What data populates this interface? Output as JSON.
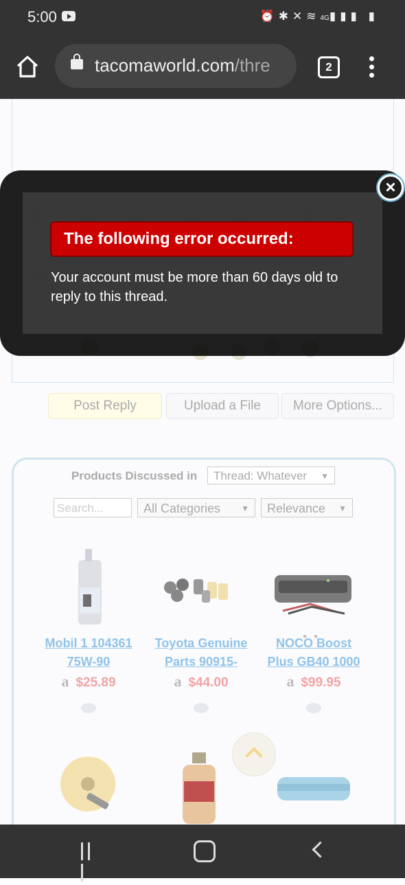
{
  "status_bar": {
    "time": "5:00",
    "icons": [
      "alarm-icon",
      "bluetooth-icon",
      "mute-icon",
      "wifi-icon",
      "lte-icon",
      "signal-icon",
      "battery-icon"
    ],
    "network_label": "4G"
  },
  "browser": {
    "url_main": "tacomaworld.com",
    "url_rest": "/thre",
    "tab_count": "2"
  },
  "editor_buttons": {
    "post_reply": "Post Reply",
    "upload_file": "Upload a File",
    "more_options": "More Options..."
  },
  "products": {
    "heading": "Products Discussed in",
    "thread_select": "Thread: Whatever",
    "search_placeholder": "Search...",
    "category": "All Categories",
    "sort": "Relevance",
    "items": [
      {
        "title_line1": "Mobil 1 104361",
        "title_line2": "75W-90",
        "price": "$25.89",
        "store_icon": "amazon-icon"
      },
      {
        "title_line1": "Toyota Genuine",
        "title_line2": "Parts 90915-",
        "price": "$44.00",
        "store_icon": "amazon-icon"
      },
      {
        "title_line1": "NOCO Boost",
        "title_line2": "Plus GB40 1000",
        "price": "$99.95",
        "store_icon": "amazon-icon"
      }
    ],
    "amazon_glyph": "a"
  },
  "error_dialog": {
    "title": "The following error occurred:",
    "message": "Your account must be more than 60 days old to reply to this thread.",
    "close_glyph": "×"
  },
  "colors": {
    "error_red": "#cc0000",
    "link_blue": "#8fc3e9",
    "price_red": "#f2a3a3",
    "chrome_dark": "#333333"
  }
}
